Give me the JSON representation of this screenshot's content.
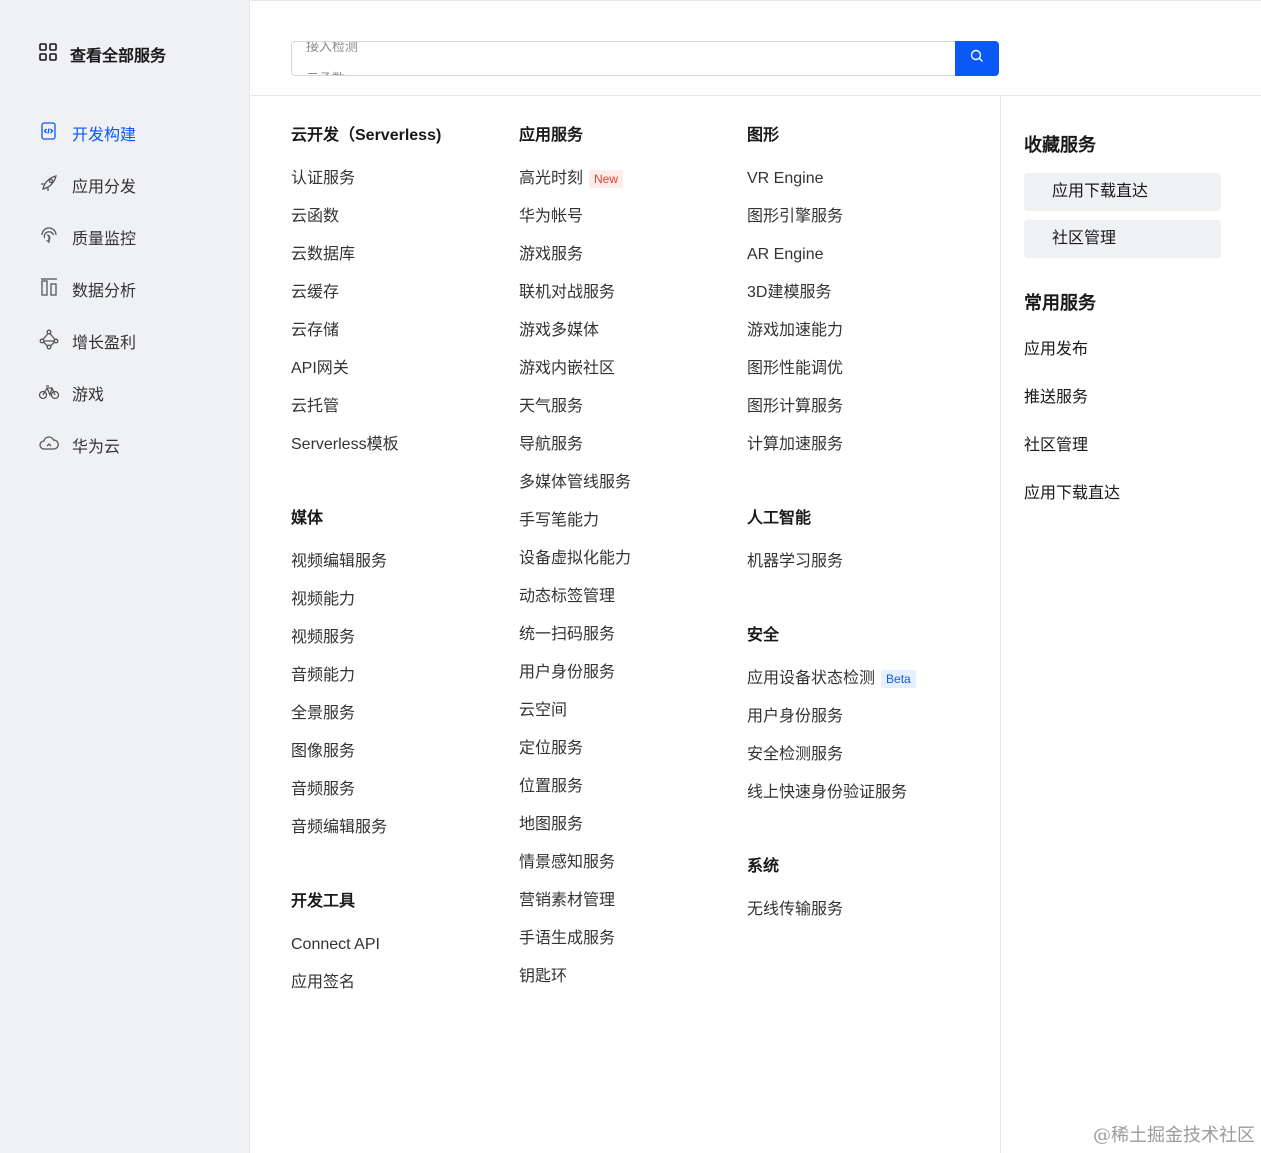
{
  "sidebar": {
    "header": "查看全部服务",
    "items": [
      {
        "label": "开发构建",
        "icon": "code-file-icon",
        "active": true
      },
      {
        "label": "应用分发",
        "icon": "rocket-icon"
      },
      {
        "label": "质量监控",
        "icon": "fingerprint-icon"
      },
      {
        "label": "数据分析",
        "icon": "bar-columns-icon"
      },
      {
        "label": "增长盈利",
        "icon": "growth-nodes-icon"
      },
      {
        "label": "游戏",
        "icon": "bicycle-icon"
      },
      {
        "label": "华为云",
        "icon": "cloud-icon"
      }
    ]
  },
  "search": {
    "placeholder_line1": "接入检测",
    "placeholder_line2": "云函数",
    "button_icon": "search-icon"
  },
  "columns": [
    [
      {
        "title": "云开发（Serverless)",
        "items": [
          {
            "label": "认证服务"
          },
          {
            "label": "云函数"
          },
          {
            "label": "云数据库"
          },
          {
            "label": "云缓存"
          },
          {
            "label": "云存储"
          },
          {
            "label": "API网关"
          },
          {
            "label": "云托管"
          },
          {
            "label": "Serverless模板"
          }
        ]
      },
      {
        "title": "媒体",
        "items": [
          {
            "label": "视频编辑服务"
          },
          {
            "label": "视频能力"
          },
          {
            "label": "视频服务"
          },
          {
            "label": "音频能力"
          },
          {
            "label": "全景服务"
          },
          {
            "label": "图像服务"
          },
          {
            "label": "音频服务"
          },
          {
            "label": "音频编辑服务"
          }
        ]
      },
      {
        "title": "开发工具",
        "items": [
          {
            "label": "Connect API"
          },
          {
            "label": "应用签名"
          }
        ]
      }
    ],
    [
      {
        "title": "应用服务",
        "items": [
          {
            "label": "高光时刻",
            "badge": "New"
          },
          {
            "label": "华为帐号"
          },
          {
            "label": "游戏服务"
          },
          {
            "label": "联机对战服务"
          },
          {
            "label": "游戏多媒体"
          },
          {
            "label": "游戏内嵌社区"
          },
          {
            "label": "天气服务"
          },
          {
            "label": "导航服务"
          },
          {
            "label": "多媒体管线服务"
          },
          {
            "label": "手写笔能力"
          },
          {
            "label": "设备虚拟化能力"
          },
          {
            "label": "动态标签管理"
          },
          {
            "label": "统一扫码服务"
          },
          {
            "label": "用户身份服务"
          },
          {
            "label": "云空间"
          },
          {
            "label": "定位服务"
          },
          {
            "label": "位置服务"
          },
          {
            "label": "地图服务"
          },
          {
            "label": "情景感知服务"
          },
          {
            "label": "营销素材管理"
          },
          {
            "label": "手语生成服务"
          },
          {
            "label": "钥匙环"
          }
        ]
      }
    ],
    [
      {
        "title": "图形",
        "items": [
          {
            "label": "VR Engine"
          },
          {
            "label": "图形引擎服务"
          },
          {
            "label": "AR Engine"
          },
          {
            "label": "3D建模服务"
          },
          {
            "label": "游戏加速能力"
          },
          {
            "label": "图形性能调优"
          },
          {
            "label": "图形计算服务"
          },
          {
            "label": "计算加速服务"
          }
        ]
      },
      {
        "title": "人工智能",
        "items": [
          {
            "label": "机器学习服务"
          }
        ]
      },
      {
        "title": "安全",
        "items": [
          {
            "label": "应用设备状态检测",
            "badge": "Beta"
          },
          {
            "label": "用户身份服务"
          },
          {
            "label": "安全检测服务"
          },
          {
            "label": "线上快速身份验证服务"
          }
        ]
      },
      {
        "title": "系统",
        "items": [
          {
            "label": "无线传输服务"
          }
        ]
      }
    ]
  ],
  "favorites": {
    "title": "收藏服务",
    "items": [
      "应用下载直达",
      "社区管理"
    ]
  },
  "common": {
    "title": "常用服务",
    "items": [
      "应用发布",
      "推送服务",
      "社区管理",
      "应用下载直达"
    ]
  },
  "watermark": "@稀土掘金技术社区",
  "colors": {
    "accent": "#0a59f7",
    "sidebar_bg": "#f0f1f5",
    "new_badge": "#e84026"
  }
}
